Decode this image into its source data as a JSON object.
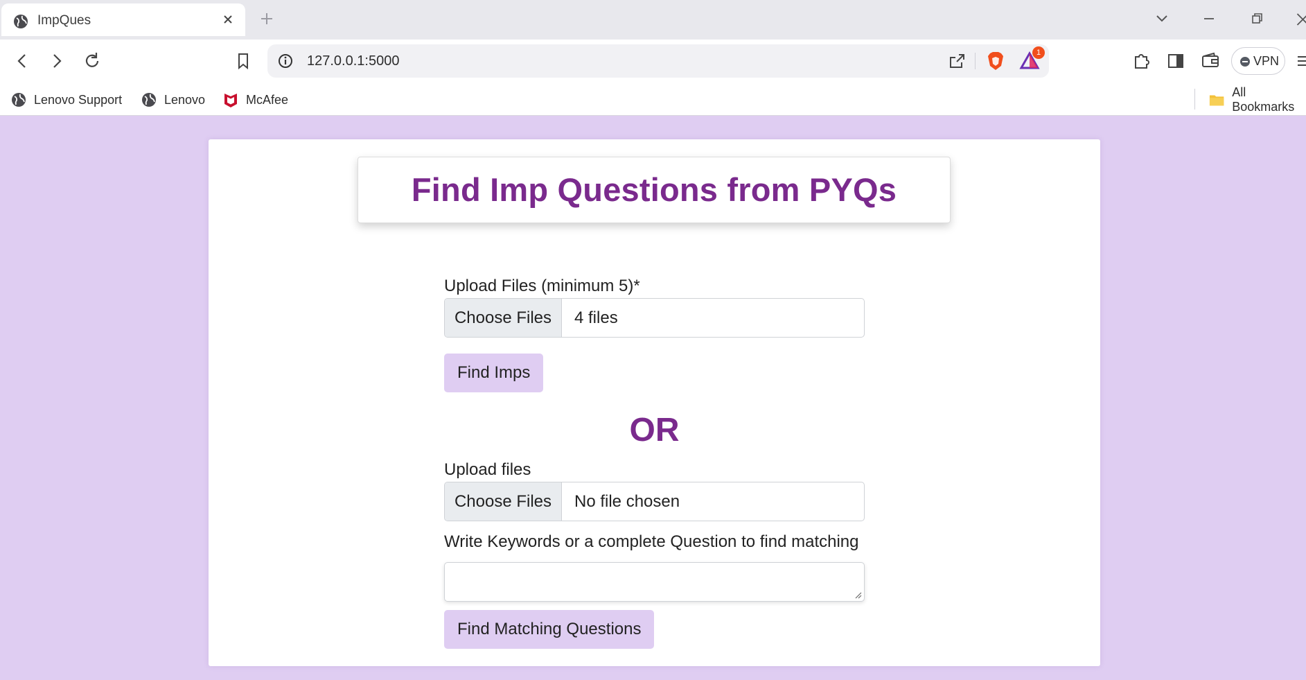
{
  "browser": {
    "tab": {
      "title": "ImpQues"
    },
    "address_bar": {
      "url": "127.0.0.1:5000"
    },
    "notification_badge": "1",
    "vpn_label": "VPN",
    "bookmarks": [
      {
        "label": "Lenovo Support",
        "icon": "globe-icon"
      },
      {
        "label": "Lenovo",
        "icon": "globe-icon"
      },
      {
        "label": "McAfee",
        "icon": "mcafee-icon"
      }
    ],
    "all_bookmarks_label": "All Bookmarks"
  },
  "page": {
    "title": "Find Imp Questions from PYQs",
    "section1": {
      "label": "Upload Files (minimum 5)*",
      "choose_label": "Choose Files",
      "file_status": "4 files",
      "submit_label": "Find Imps"
    },
    "divider": "OR",
    "section2": {
      "label": "Upload files",
      "choose_label": "Choose Files",
      "file_status": "No file chosen",
      "keywords_label": "Write Keywords or a complete Question to find matching",
      "keywords_value": "",
      "submit_label": "Find Matching Questions"
    }
  },
  "colors": {
    "page_background": "#dfcdf2",
    "accent_purple": "#7a2a8d",
    "button_background": "#dfcdf2",
    "brave_orange": "#f14e1c"
  }
}
